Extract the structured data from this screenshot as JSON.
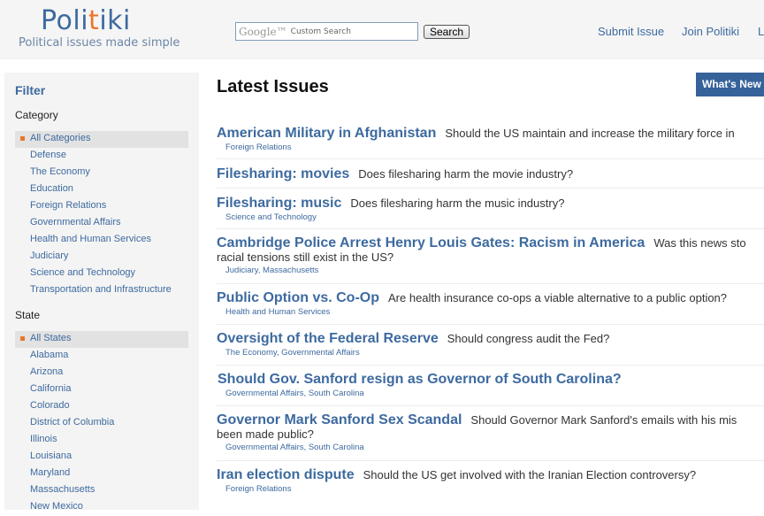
{
  "header": {
    "logo_part1": "Poli",
    "logo_part2": "t",
    "logo_part3": "iki",
    "tagline": "Political issues made simple",
    "search_brand": "Google™",
    "search_placeholder": "Custom Search",
    "search_button": "Search",
    "nav": [
      "Submit Issue",
      "Join Politiki",
      "L"
    ]
  },
  "sidebar": {
    "title": "Filter",
    "category_label": "Category",
    "categories": [
      "All Categories",
      "Defense",
      "The Economy",
      "Education",
      "Foreign Relations",
      "Governmental Affairs",
      "Health and Human Services",
      "Judiciary",
      "Science and Technology",
      "Transportation and Infrastructure"
    ],
    "state_label": "State",
    "states": [
      "All States",
      "Alabama",
      "Arizona",
      "California",
      "Colorado",
      "District of Columbia",
      "Illinois",
      "Louisiana",
      "Maryland",
      "Massachusetts",
      "New Mexico"
    ]
  },
  "main": {
    "title": "Latest Issues",
    "whats_new": "What's New",
    "issues": [
      {
        "title": "American Military in Afghanistan",
        "question": "Should the US maintain and increase the military force in",
        "cont": "",
        "tags": "Foreign Relations"
      },
      {
        "title": "Filesharing: movies",
        "question": "Does filesharing harm the movie industry?",
        "cont": "",
        "tags": ""
      },
      {
        "title": "Filesharing: music",
        "question": "Does filesharing harm the music industry?",
        "cont": "",
        "tags": "Science and Technology"
      },
      {
        "title": "Cambridge Police Arrest Henry Louis Gates: Racism in America",
        "question": "Was this news sto",
        "cont": "racial tensions still exist in the US?",
        "tags": "Judiciary, Massachusetts"
      },
      {
        "title": "Public Option vs. Co-Op",
        "question": "Are health insurance co-ops a viable alternative to a public option?",
        "cont": "",
        "tags": "Health and Human Services"
      },
      {
        "title": "Oversight of the Federal Reserve",
        "question": "Should congress audit the Fed?",
        "cont": "",
        "tags": "The Economy, Governmental Affairs"
      },
      {
        "title": "Should Gov. Sanford resign as Governor of South Carolina?",
        "question": "",
        "cont": "",
        "tags": "Governmental Affairs, South Carolina"
      },
      {
        "title": "Governor Mark Sanford Sex Scandal",
        "question": "Should Governor Mark Sanford's emails with his mis",
        "cont": "been made public?",
        "tags": "Governmental Affairs, South Carolina"
      },
      {
        "title": "Iran election dispute",
        "question": "Should the US get involved with the Iranian Election controversy?",
        "cont": "",
        "tags": "Foreign Relations"
      }
    ]
  },
  "colors": {
    "brand_blue": "#3d6a9f",
    "accent_orange": "#e9762b",
    "button_blue": "#36629a"
  }
}
